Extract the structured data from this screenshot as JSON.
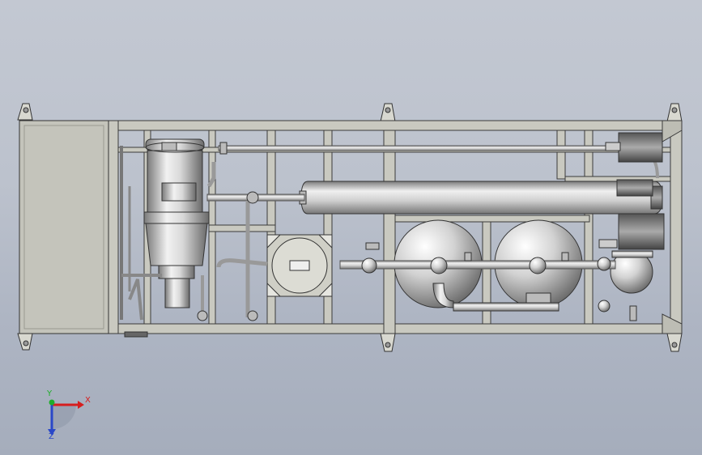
{
  "viewport": {
    "background_top": "#c3c8d2",
    "background_bottom": "#a5adbc"
  },
  "model": {
    "frame_color": "#c8c8c0",
    "frame_edge": "#3a3a3a",
    "metal_light": "#eeeeee",
    "metal_dark": "#6e6e6e"
  },
  "triad": {
    "x_label": "X",
    "y_label": "Y",
    "z_label": "Z",
    "x_color": "#d61e1e",
    "y_color": "#1fae2a",
    "z_color": "#2a48c8"
  }
}
